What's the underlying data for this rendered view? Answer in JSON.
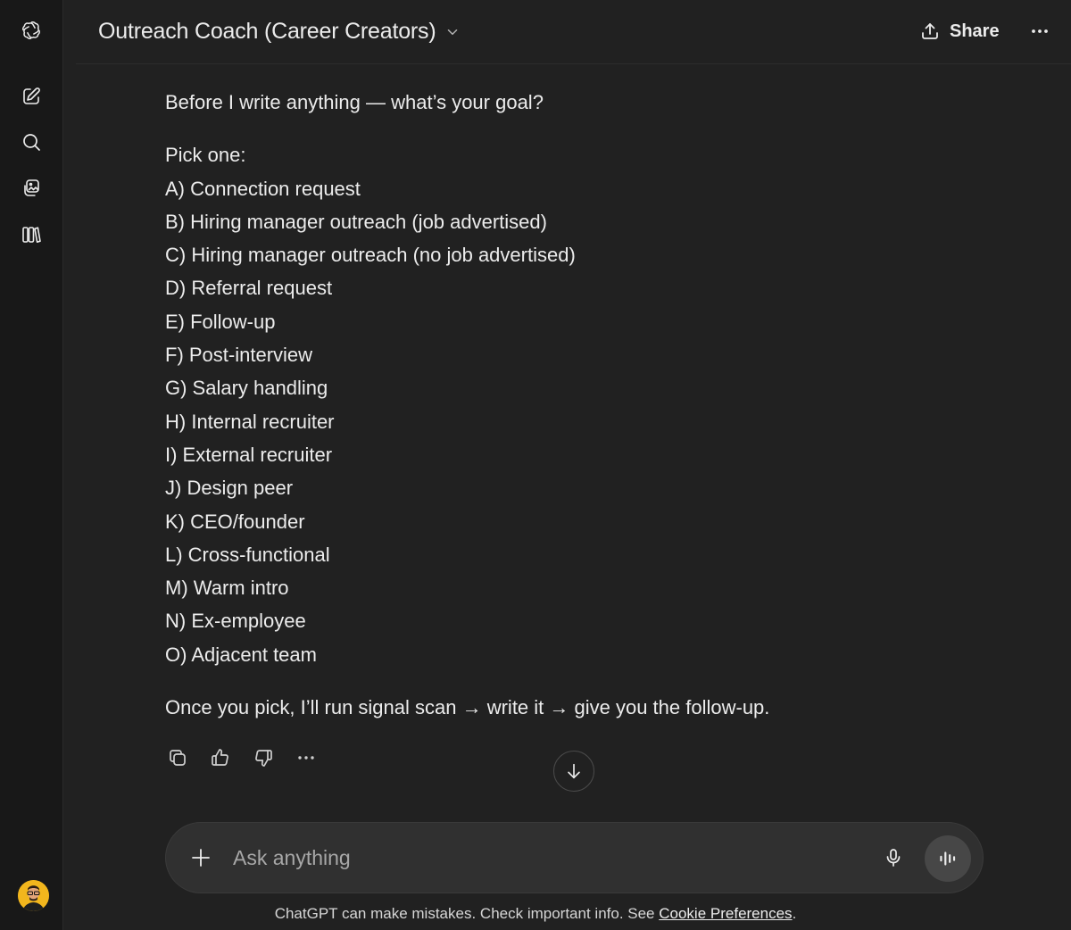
{
  "header": {
    "title": "Outreach Coach (Career Creators)",
    "share_label": "Share"
  },
  "sidebar": {
    "icons": [
      "openai-logo-icon",
      "new-chat-icon",
      "search-icon",
      "images-icon",
      "library-icon"
    ]
  },
  "message": {
    "intro": "Before I write anything — what’s your goal?",
    "pick_label": "Pick one:",
    "options": [
      "A) Connection request",
      "B) Hiring manager outreach (job advertised)",
      "C) Hiring manager outreach (no job advertised)",
      "D) Referral request",
      "E) Follow-up",
      "F) Post-interview",
      "G) Salary handling",
      "H) Internal recruiter",
      "I) External recruiter",
      "J) Design peer",
      "K) CEO/founder",
      "L) Cross-functional",
      "M) Warm intro",
      "N) Ex-employee",
      "O) Adjacent team"
    ],
    "closing": "Once you pick, I’ll run signal scan → write it → give you the follow-up."
  },
  "composer": {
    "placeholder": "Ask anything"
  },
  "disclaimer": {
    "text": "ChatGPT can make mistakes. Check important info. See ",
    "link": "Cookie Preferences",
    "end": "."
  },
  "colors": {
    "background": "#212121",
    "sidebar": "#181818",
    "composer": "#303030",
    "avatar": "#f2b61d"
  }
}
